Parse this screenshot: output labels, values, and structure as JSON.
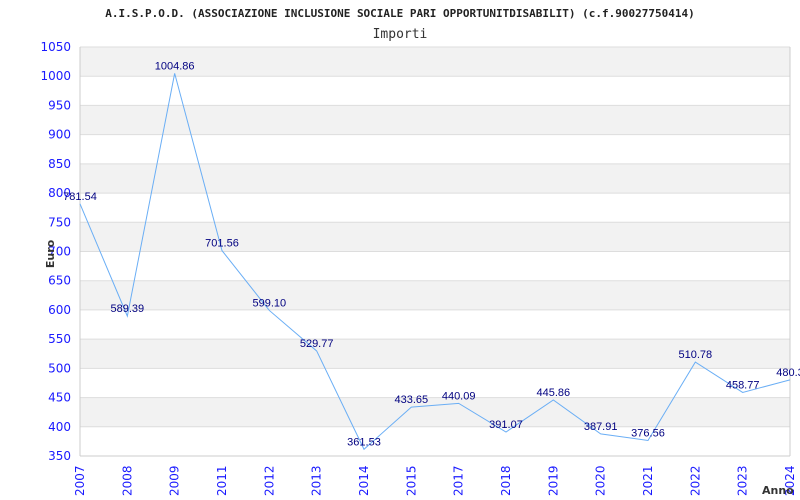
{
  "chart_data": {
    "type": "line",
    "title": "A.I.S.P.O.D. (ASSOCIAZIONE INCLUSIONE SOCIALE PARI OPPORTUNITDISABILIT) (c.f.90027750414)",
    "subtitle": "Importi",
    "xlabel": "Anno",
    "ylabel": "Euro",
    "ylim": [
      350,
      1050
    ],
    "yticks": [
      350,
      400,
      450,
      500,
      550,
      600,
      650,
      700,
      750,
      800,
      850,
      900,
      950,
      1000,
      1050
    ],
    "categories": [
      "2007",
      "2008",
      "2009",
      "2011",
      "2012",
      "2013",
      "2014",
      "2015",
      "2017",
      "2018",
      "2019",
      "2020",
      "2021",
      "2022",
      "2023",
      "2024"
    ],
    "values": [
      781.54,
      589.39,
      1004.86,
      701.56,
      599.1,
      529.77,
      361.53,
      433.65,
      440.09,
      391.07,
      445.86,
      387.91,
      376.56,
      510.78,
      458.77,
      480.3
    ],
    "labels": [
      "781.54",
      "589.39",
      "1004.86",
      "701.56",
      "599.10",
      "529.77",
      "361.53",
      "433.65",
      "440.09",
      "391.07",
      "445.86",
      "387.91",
      "376.56",
      "510.78",
      "458.77",
      "480.3"
    ],
    "grid": true,
    "colors": {
      "line": "#6aaef5",
      "band": "#f2f2f2",
      "tick": "#1a1aff",
      "label": "#000080"
    }
  }
}
